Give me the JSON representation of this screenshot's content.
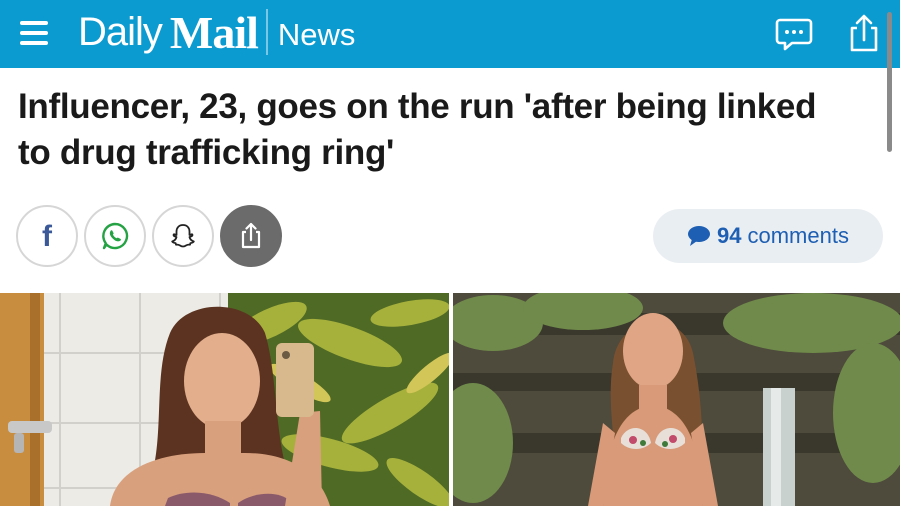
{
  "header": {
    "brand_daily": "Daily",
    "brand_mail": "Mail",
    "section": "News",
    "bar_color": "#0c9bd1",
    "icons": [
      "menu-icon",
      "comment-bubble-icon",
      "share-icon"
    ]
  },
  "article": {
    "headline": "Influencer, 23, goes on the run 'after being linked to drug trafficking ring'"
  },
  "share": {
    "buttons": [
      "facebook-icon",
      "whatsapp-icon",
      "snapchat-icon",
      "share-icon"
    ],
    "facebook_glyph": "f",
    "comments_count": "94",
    "comments_label": "comments",
    "accent_color": "#1e5fb3"
  },
  "photos": [
    {
      "description_icon": "photo-selfie"
    },
    {
      "description_icon": "photo-waterfall"
    }
  ]
}
